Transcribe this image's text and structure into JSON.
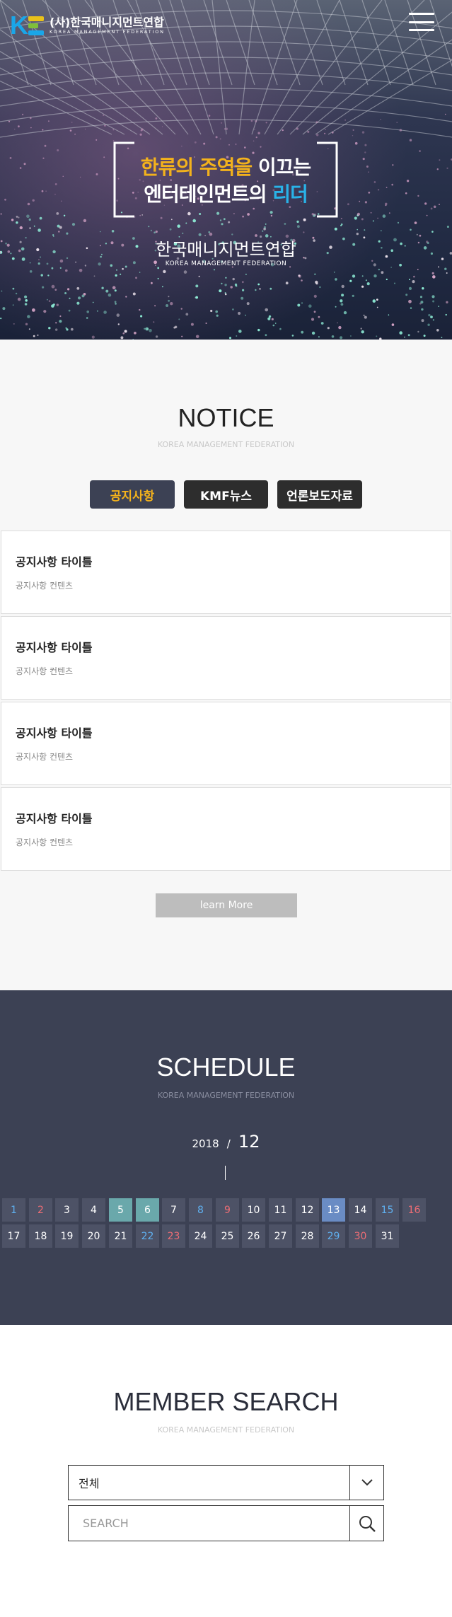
{
  "header": {
    "logo_letter": "K",
    "logo_name": "(사)한국매니지먼트연합",
    "logo_en": "KOREA MANAGEMENT FEDERATION",
    "menu_icon": "hamburger-icon",
    "logo_colors": [
      "#1aa6e8",
      "#e9c21a",
      "#7fbf3a"
    ]
  },
  "hero": {
    "line1_a": "한류의 주역을",
    "line1_b": " 이끄는",
    "line2_a": "엔터테인먼트의 ",
    "line2_b": "리더",
    "title": "한국매니지먼트연합",
    "subtitle": "KOREA MANAGEMENT FEDERATION",
    "accent_yellow": "#f3b21c",
    "accent_blue": "#29b3e8"
  },
  "notice": {
    "title": "NOTICE",
    "subtitle": "KOREA MANAGEMENT FEDERATION",
    "tabs": [
      {
        "label": "공지사항"
      },
      {
        "label": "KMF뉴스"
      },
      {
        "label": "언론보도자료"
      }
    ],
    "items": [
      {
        "title": "공지사항 타이틀",
        "desc": "공지사항 컨텐츠"
      },
      {
        "title": "공지사항 타이틀",
        "desc": "공지사항 컨텐츠"
      },
      {
        "title": "공지사항 타이틀",
        "desc": "공지사항 컨텐츠"
      },
      {
        "title": "공지사항 타이틀",
        "desc": "공지사항 컨텐츠"
      }
    ],
    "more_label": "learn More"
  },
  "schedule": {
    "title": "SCHEDULE",
    "subtitle": "KOREA MANAGEMENT FEDERATION",
    "year": "2018",
    "separator": "/",
    "month": "12",
    "days": [
      "1",
      "2",
      "3",
      "4",
      "5",
      "6",
      "7",
      "8",
      "9",
      "10",
      "11",
      "12",
      "13",
      "14",
      "15",
      "16",
      "17",
      "18",
      "19",
      "20",
      "21",
      "22",
      "23",
      "24",
      "25",
      "26",
      "27",
      "28",
      "29",
      "30",
      "31"
    ],
    "event_days": [
      "5",
      "6"
    ],
    "selected_day": "13",
    "saturdays": [
      "1",
      "8",
      "15",
      "22",
      "29"
    ],
    "sundays": [
      "2",
      "9",
      "16",
      "23",
      "30"
    ]
  },
  "member": {
    "title": "MEMBER SEARCH",
    "subtitle": "KOREA MANAGEMENT FEDERATION",
    "select_value": "전체",
    "search_placeholder": "SEARCH",
    "search_value": ""
  }
}
